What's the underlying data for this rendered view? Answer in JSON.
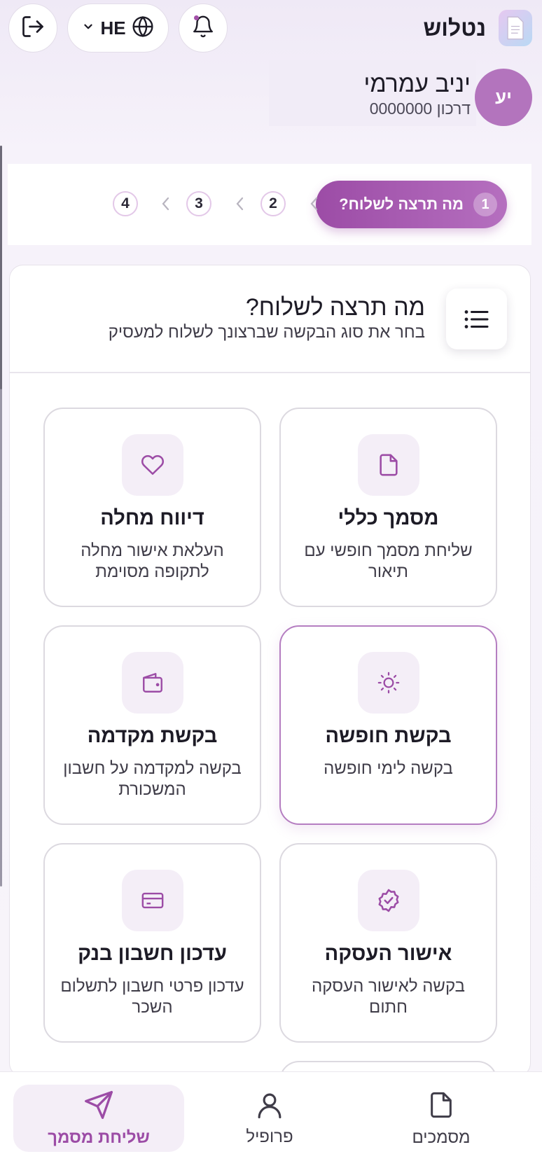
{
  "header": {
    "brand_name": "נטלוש",
    "language_code": "HE",
    "icons": {
      "logout": "logout-icon",
      "language": "globe-icon",
      "chevron": "chevron-down-icon",
      "notifications": "bell-icon",
      "logo": "document-icon"
    }
  },
  "profile": {
    "initials": "יע",
    "name": "יניב עמרמי",
    "passport_label": "דרכון 0000000"
  },
  "stepper": {
    "active_step": {
      "number": "1",
      "label": "מה תרצה לשלוח?"
    },
    "steps": [
      "2",
      "3",
      "4"
    ]
  },
  "card": {
    "title": "מה תרצה לשלוח?",
    "subtitle": "בחר את סוג הבקשה שברצונך לשלוח למעסיק",
    "menu_icon": "list-icon"
  },
  "tiles": [
    {
      "title": "מסמך כללי",
      "description": "שליחת מסמך חופשי עם תיאור",
      "icon": "file-icon",
      "selected": false
    },
    {
      "title": "דיווח מחלה",
      "description": "העלאת אישור מחלה לתקופה מסוימת",
      "icon": "heart-icon",
      "selected": false
    },
    {
      "title": "בקשת חופשה",
      "description": "בקשה לימי חופשה",
      "icon": "sun-icon",
      "selected": true
    },
    {
      "title": "בקשת מקדמה",
      "description": "בקשה למקדמה על חשבון המשכורת",
      "icon": "wallet-icon",
      "selected": false
    },
    {
      "title": "אישור העסקה",
      "description": "בקשה לאישור העסקה חתום",
      "icon": "badge-check-icon",
      "selected": false
    },
    {
      "title": "עדכון חשבון בנק",
      "description": "עדכון פרטי חשבון לתשלום השכר",
      "icon": "credit-card-icon",
      "selected": false
    }
  ],
  "bottom_nav": {
    "send": "שליחת מסמך",
    "profile": "פרופיל",
    "documents": "מסמכים"
  },
  "colors": {
    "accent": "#9c4ca6",
    "accent_light": "#f4eef7",
    "selected_border": "#b57ec1"
  }
}
